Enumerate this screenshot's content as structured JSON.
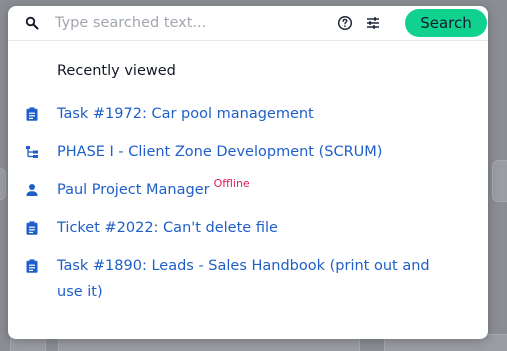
{
  "search": {
    "placeholder": "Type searched text...",
    "button_label": "Search"
  },
  "recent": {
    "title": "Recently viewed",
    "items": [
      {
        "label": "Task #1972: Car pool management",
        "icon": "clipboard-icon"
      },
      {
        "label": "PHASE I - Client Zone Development (SCRUM)",
        "icon": "hierarchy-icon"
      },
      {
        "label": "Paul Project Manager",
        "icon": "person-icon",
        "badge": "Offline"
      },
      {
        "label": "Ticket #2022: Can't delete file",
        "icon": "clipboard-icon"
      },
      {
        "label": "Task #1890: Leads - Sales Handbook (print out and use it)",
        "icon": "clipboard-icon"
      }
    ]
  },
  "colors": {
    "accent": "#11d18f",
    "link": "#1f5fc9",
    "badge": "#e21b5a"
  }
}
